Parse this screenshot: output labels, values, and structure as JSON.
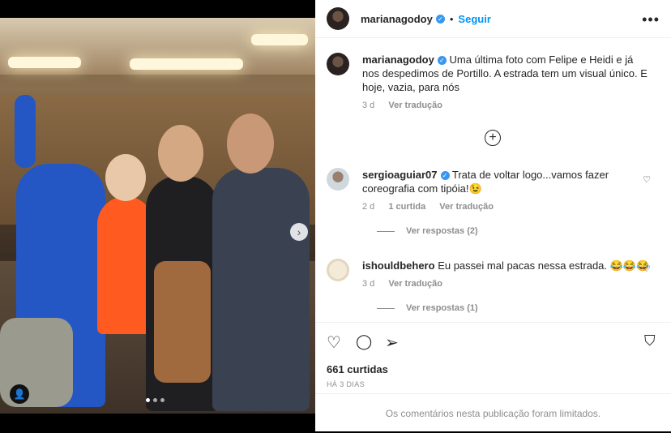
{
  "post": {
    "author": "marianagodoy",
    "follow_label": "Seguir",
    "separator": "•",
    "more_label": "•••"
  },
  "caption": {
    "username": "marianagodoy",
    "text": "Uma última foto com Felipe e Heidi e já nos despedimos de Portillo. A estrada tem um visual único. E hoje, vazia, para nós",
    "time": "3 d",
    "translate": "Ver tradução"
  },
  "comments": [
    {
      "username": "sergioaguiar07",
      "text": "Trata de voltar logo...vamos fazer coreografia com tipóia!😉",
      "time": "2 d",
      "likes": "1 curtida",
      "translate": "Ver tradução",
      "replies": "Ver respostas (2)"
    },
    {
      "username": "ishouldbehero",
      "text": "Eu passei mal pacas nessa estrada. 😂😂😂",
      "time": "3 d",
      "translate": "Ver tradução",
      "replies": "Ver respostas (1)"
    }
  ],
  "actions": {
    "likes": "661 curtidas",
    "date": "HÁ 3 DIAS",
    "limited": "Os comentários nesta publicação foram limitados."
  },
  "icons": {
    "verified": "verified-badge-icon",
    "plus": "load-more-icon",
    "heart": "heart-icon",
    "comment": "comment-icon",
    "share": "share-icon",
    "save": "bookmark-icon",
    "carousel_next": "chevron-right-icon",
    "tag": "user-tag-icon"
  },
  "colors": {
    "accent": "#0095f6",
    "verified": "#3897f0",
    "muted": "#8e8e8e",
    "text": "#262626"
  }
}
